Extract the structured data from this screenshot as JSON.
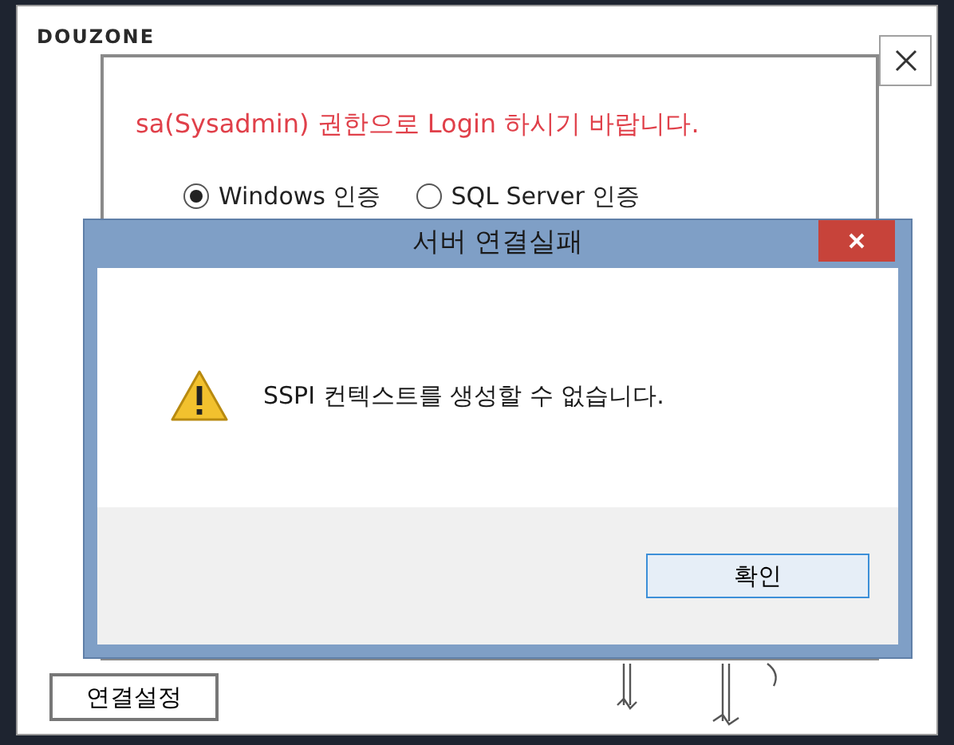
{
  "app_window": {
    "logo": "DOUZONE",
    "notice": "sa(Sysadmin) 권한으로 Login 하시기 바랍니다.",
    "auth_options": [
      {
        "label": "Windows 인증",
        "selected": true
      },
      {
        "label": "SQL Server 인증",
        "selected": false
      }
    ],
    "connection_settings_button": "연결설정"
  },
  "dialog": {
    "title": "서버 연결실패",
    "message": "SSPI 컨텍스트를 생성할 수 없습니다.",
    "ok_button": "확인"
  }
}
